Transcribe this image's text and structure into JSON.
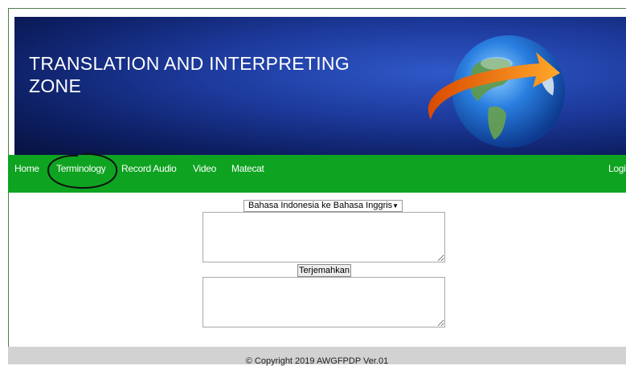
{
  "banner": {
    "title": "TRANSLATION AND INTERPRETING ZONE"
  },
  "nav": {
    "items": [
      {
        "label": "Home"
      },
      {
        "label": "Terminology"
      },
      {
        "label": "Record Audio"
      },
      {
        "label": "Video"
      },
      {
        "label": "Matecat"
      }
    ],
    "login_label": "Logi"
  },
  "translator": {
    "language_select": "Bahasa Indonesia ke Bahasa Inggris",
    "source_text": "",
    "translate_button": "Terjemahkan",
    "result_text": ""
  },
  "footer": {
    "copyright": "© Copyright 2019 AWGFPDP Ver.01"
  },
  "colors": {
    "navbar": "#0ea321",
    "banner": "#1d3a9c",
    "footer": "#d2d2d2"
  }
}
